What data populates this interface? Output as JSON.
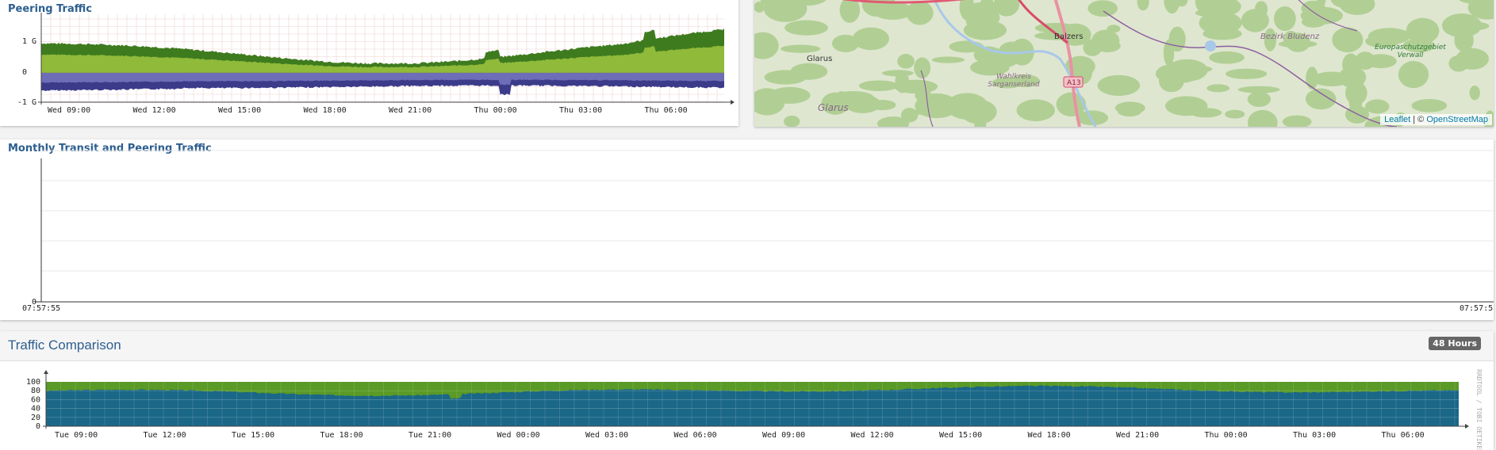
{
  "peering": {
    "title": "Peering Traffic",
    "y_labels": [
      "1 G",
      "0",
      "-1 G"
    ],
    "x_labels": [
      "Wed 09:00",
      "Wed 12:00",
      "Wed 15:00",
      "Wed 18:00",
      "Wed 21:00",
      "Thu 00:00",
      "Thu 03:00",
      "Thu 06:00"
    ],
    "colors": {
      "dark_green": "#3e7b1f",
      "light_green": "#8fba3a",
      "purple": "#6d6db8",
      "dark_purple": "#3b3b8a"
    }
  },
  "map": {
    "labels": {
      "glarus_town": "Glarus",
      "glarus_region": "Glarus",
      "balzers": "Balzers",
      "wahlkreis": "Wahlkreis Sarganserland",
      "bludenz": "Bezirk Bludenz",
      "europaschutz": "Europaschutzgebiet Verwall",
      "road": "A13"
    },
    "attribution": {
      "leaflet": "Leaflet",
      "separator": " | © ",
      "osm": "OpenStreetMap"
    }
  },
  "monthly": {
    "title": "Monthly Transit and Peering Traffic",
    "y_zero": "0",
    "x_start": "07:57:55",
    "x_end": "07:57:5"
  },
  "comparison": {
    "title": "Traffic Comparison",
    "badge": "48 Hours",
    "y_labels": [
      "100",
      "80",
      "60",
      "40",
      "20",
      "0"
    ],
    "x_labels": [
      "Tue 09:00",
      "Tue 12:00",
      "Tue 15:00",
      "Tue 18:00",
      "Tue 21:00",
      "Wed 00:00",
      "Wed 03:00",
      "Wed 06:00",
      "Wed 09:00",
      "Wed 12:00",
      "Wed 15:00",
      "Wed 18:00",
      "Wed 21:00",
      "Thu 00:00",
      "Thu 03:00",
      "Thu 06:00"
    ],
    "side_text": "RRDTOOL / TOBI OETIKER",
    "colors": {
      "green": "#5a9a26",
      "blue": "#1b6788"
    }
  }
}
